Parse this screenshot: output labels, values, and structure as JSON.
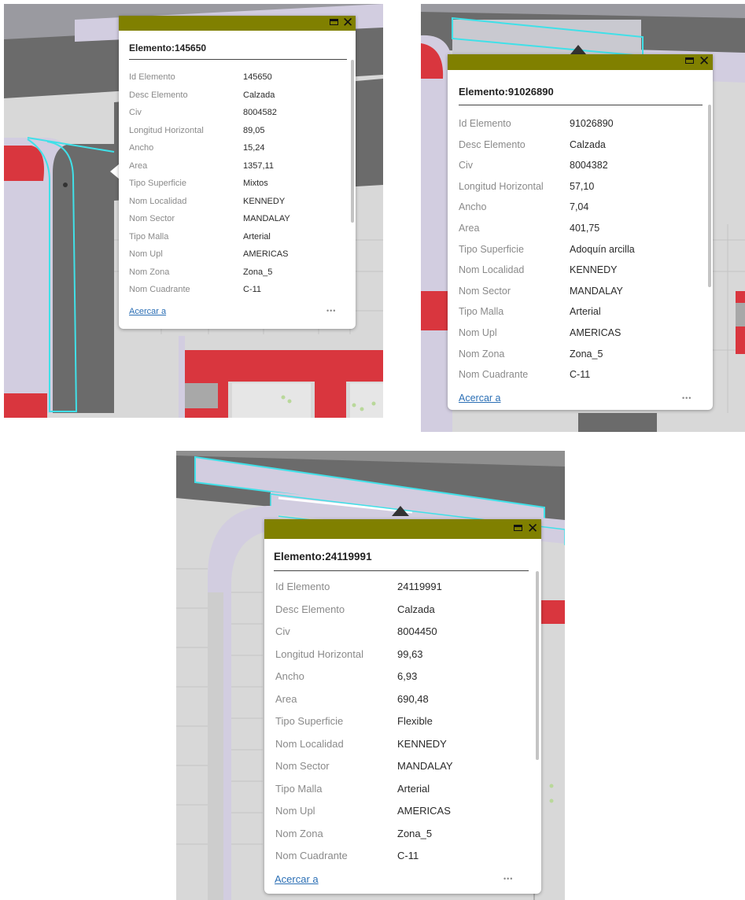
{
  "popups": [
    {
      "title": "Elemento:145650",
      "rows": [
        {
          "label": "Id Elemento",
          "value": "145650"
        },
        {
          "label": "Desc Elemento",
          "value": "Calzada"
        },
        {
          "label": "Civ",
          "value": "8004582"
        },
        {
          "label": "Longitud Horizontal",
          "value": "89,05"
        },
        {
          "label": "Ancho",
          "value": "15,24"
        },
        {
          "label": "Area",
          "value": "1357,11"
        },
        {
          "label": "Tipo Superficie",
          "value": "Mixtos"
        },
        {
          "label": "Nom Localidad",
          "value": "KENNEDY"
        },
        {
          "label": "Nom Sector",
          "value": "MANDALAY"
        },
        {
          "label": "Tipo Malla",
          "value": "Arterial"
        },
        {
          "label": "Nom Upl",
          "value": "AMERICAS"
        },
        {
          "label": "Nom Zona",
          "value": "Zona_5"
        },
        {
          "label": "Nom Cuadrante",
          "value": "C-11"
        }
      ],
      "zoom_link": "Acercar a",
      "more": "•••"
    },
    {
      "title": "Elemento:91026890",
      "rows": [
        {
          "label": "Id Elemento",
          "value": "91026890"
        },
        {
          "label": "Desc Elemento",
          "value": "Calzada"
        },
        {
          "label": "Civ",
          "value": "8004382"
        },
        {
          "label": "Longitud Horizontal",
          "value": "57,10"
        },
        {
          "label": "Ancho",
          "value": "7,04"
        },
        {
          "label": "Area",
          "value": "401,75"
        },
        {
          "label": "Tipo Superficie",
          "value": "Adoquín arcilla"
        },
        {
          "label": "Nom Localidad",
          "value": "KENNEDY"
        },
        {
          "label": "Nom Sector",
          "value": "MANDALAY"
        },
        {
          "label": "Tipo Malla",
          "value": "Arterial"
        },
        {
          "label": "Nom Upl",
          "value": "AMERICAS"
        },
        {
          "label": "Nom Zona",
          "value": "Zona_5"
        },
        {
          "label": "Nom Cuadrante",
          "value": "C-11"
        }
      ],
      "zoom_link": "Acercar a",
      "more": "•••"
    },
    {
      "title": "Elemento:24119991",
      "rows": [
        {
          "label": "Id Elemento",
          "value": "24119991"
        },
        {
          "label": "Desc Elemento",
          "value": "Calzada"
        },
        {
          "label": "Civ",
          "value": "8004450"
        },
        {
          "label": "Longitud Horizontal",
          "value": "99,63"
        },
        {
          "label": "Ancho",
          "value": "6,93"
        },
        {
          "label": "Area",
          "value": "690,48"
        },
        {
          "label": "Tipo Superficie",
          "value": "Flexible"
        },
        {
          "label": "Nom Localidad",
          "value": "KENNEDY"
        },
        {
          "label": "Nom Sector",
          "value": "MANDALAY"
        },
        {
          "label": "Tipo Malla",
          "value": "Arterial"
        },
        {
          "label": "Nom Upl",
          "value": "AMERICAS"
        },
        {
          "label": "Nom Zona",
          "value": "Zona_5"
        },
        {
          "label": "Nom Cuadrante",
          "value": "C-11"
        }
      ],
      "zoom_link": "Acercar a",
      "more": "•••"
    }
  ],
  "colors": {
    "titlebar": "#808000",
    "selection_outline": "#40e0e8",
    "road": "#6b6b6b",
    "sidewalk": "#d2cde0",
    "red_zone": "#d9363e",
    "block": "#d8d8d8",
    "link": "#2b6fb5"
  },
  "icons": [
    "maximize-icon",
    "close-icon",
    "more-options-icon"
  ]
}
